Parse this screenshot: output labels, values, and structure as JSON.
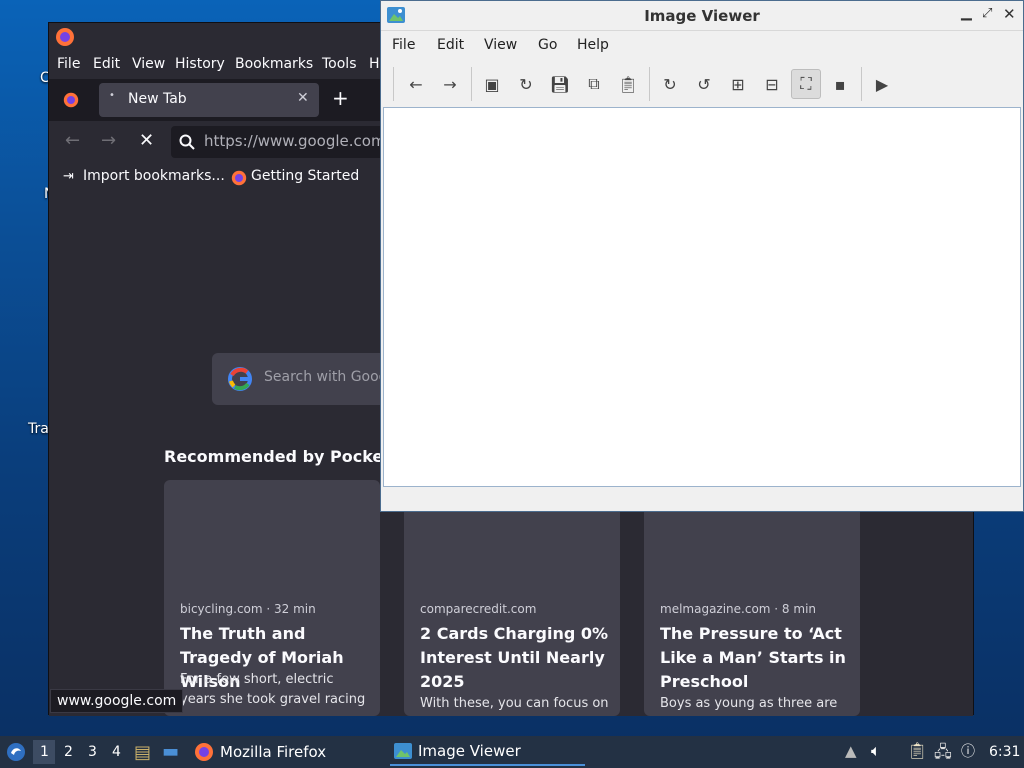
{
  "desktop": {
    "fragments": [
      "C",
      "N",
      "Tra"
    ]
  },
  "firefox": {
    "menu": [
      "File",
      "Edit",
      "View",
      "History",
      "Bookmarks",
      "Tools",
      "He"
    ],
    "tab_label": "New Tab",
    "url": "https://www.google.com/s",
    "bookmarks": [
      "Import bookmarks...",
      "Getting Started"
    ],
    "search_placeholder": "Search with Goog",
    "pocket_heading": "Recommended by Pocket",
    "cards": [
      {
        "source": "bicycling.com · 32 min",
        "headline": "The Truth and Tragedy of Moriah Wilson",
        "excerpt": "For a few short, electric years she took gravel racing"
      },
      {
        "source": "comparecredit.com",
        "headline": "2 Cards Charging 0% Interest Until Nearly 2025",
        "excerpt": "With these, you can focus on"
      },
      {
        "source": "melmagazine.com · 8 min",
        "headline": "The Pressure to ‘Act Like a Man’ Starts in Preschool",
        "excerpt": "Boys as young as three are"
      }
    ],
    "status_url": "www.google.com"
  },
  "image_viewer": {
    "title": "Image Viewer",
    "menu": [
      "File",
      "Edit",
      "View",
      "Go",
      "Help"
    ],
    "toolbar_icons": [
      "back-icon",
      "forward-icon",
      "open-icon",
      "reload-icon",
      "save-icon",
      "copy-icon",
      "paste-icon",
      "rotate-cw-icon",
      "rotate-ccw-icon",
      "zoom-in-icon",
      "zoom-out-icon",
      "fit-icon",
      "original-size-icon",
      "slideshow-icon"
    ]
  },
  "taskbar": {
    "workspaces": [
      "1",
      "2",
      "3",
      "4"
    ],
    "tasks": [
      "Mozilla Firefox",
      "Image Viewer"
    ],
    "clock": "6:31"
  }
}
